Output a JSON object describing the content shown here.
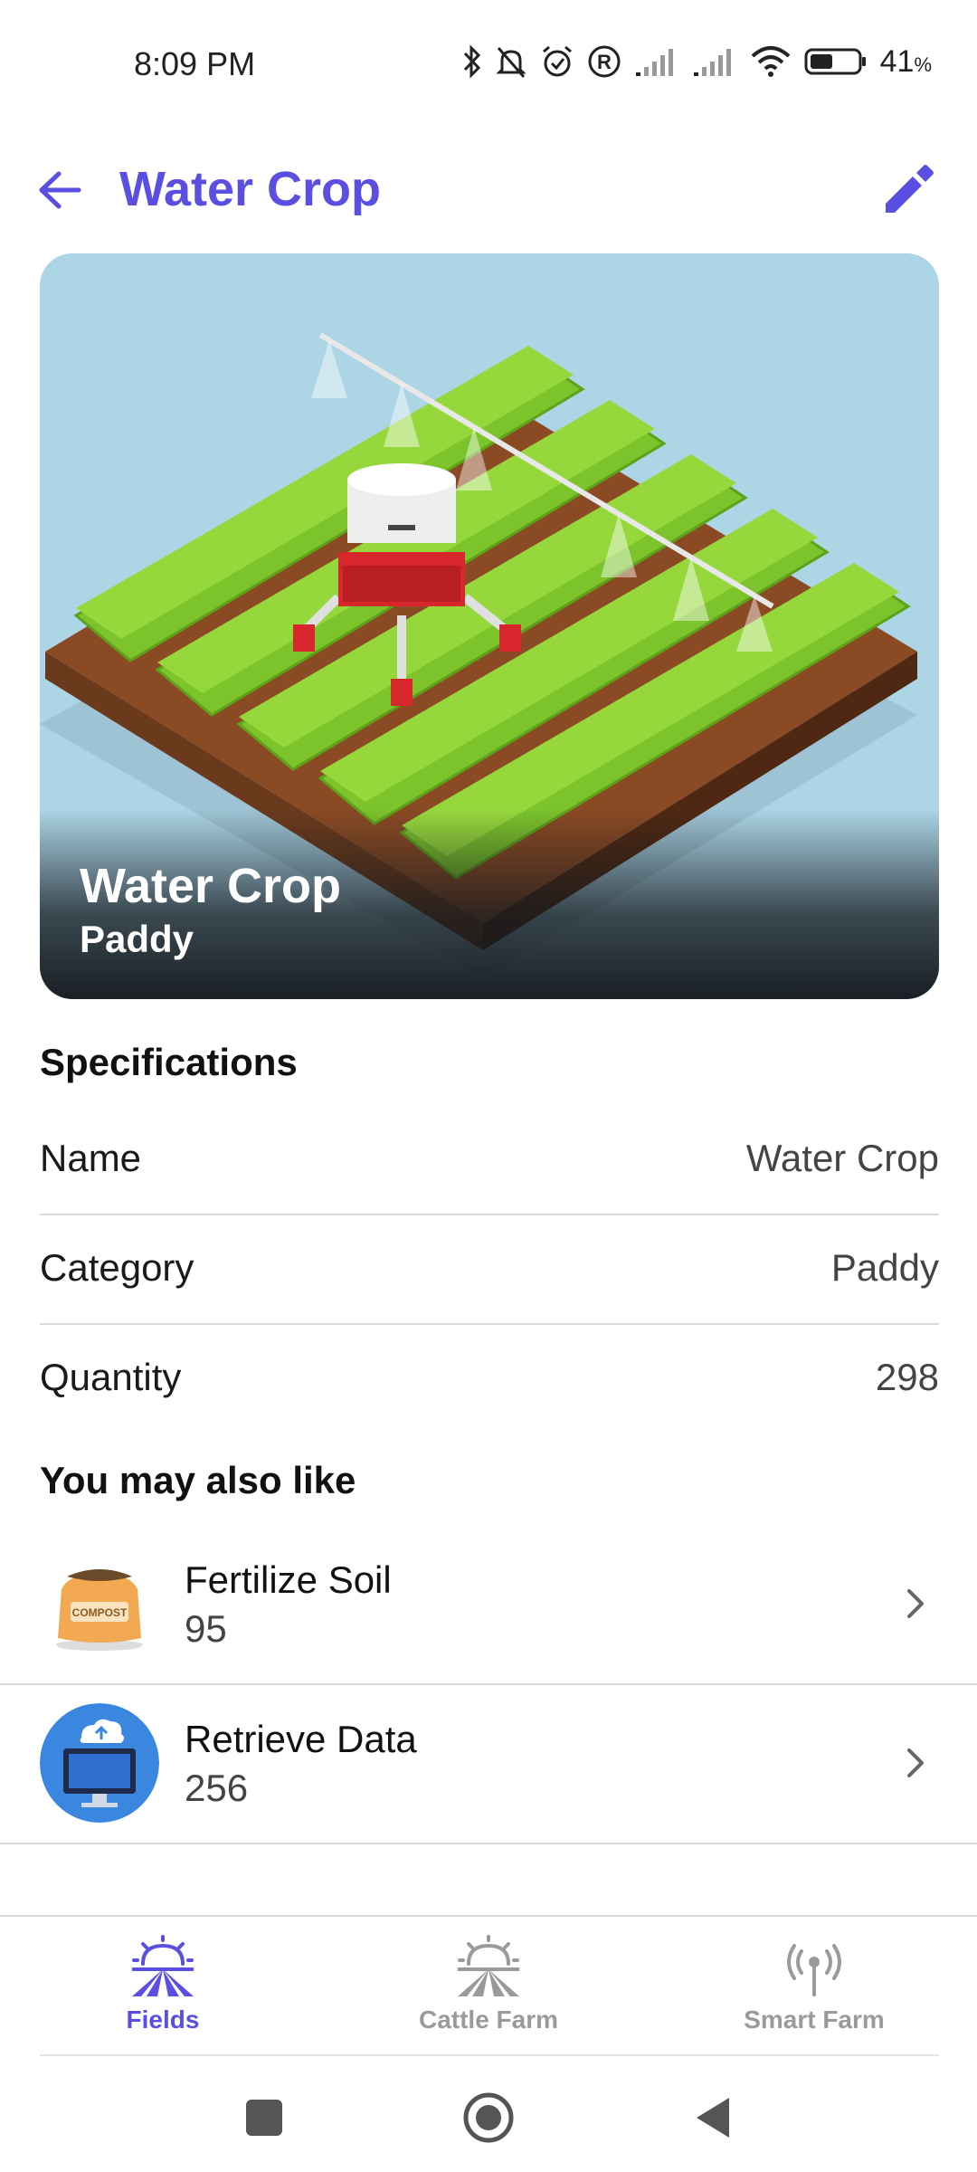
{
  "status_bar": {
    "time": "8:09 PM",
    "battery_percent": "41",
    "battery_unit": "%"
  },
  "app_bar": {
    "title": "Water Crop",
    "back_icon": "arrow-left-icon",
    "edit_icon": "pencil-icon"
  },
  "hero": {
    "title": "Water Crop",
    "subtitle": "Paddy",
    "image": "isometric-field-irrigation-robot"
  },
  "specifications": {
    "heading": "Specifications",
    "rows": [
      {
        "label": "Name",
        "value": "Water Crop"
      },
      {
        "label": "Category",
        "value": "Paddy"
      },
      {
        "label": "Quantity",
        "value": "298"
      }
    ]
  },
  "recommendations": {
    "heading": "You may also like",
    "items": [
      {
        "title": "Fertilize Soil",
        "subtitle": "95",
        "thumb": "compost-bag"
      },
      {
        "title": "Retrieve Data",
        "subtitle": "256",
        "thumb": "cloud-computer"
      }
    ]
  },
  "bottom_nav": {
    "items": [
      {
        "label": "Fields",
        "icon": "field-sunrise-icon",
        "active": true
      },
      {
        "label": "Cattle Farm",
        "icon": "field-sunrise-icon",
        "active": false
      },
      {
        "label": "Smart Farm",
        "icon": "antenna-signal-icon",
        "active": false
      }
    ]
  },
  "colors": {
    "accent": "#5a4fe0",
    "inactive": "#9a9a9a",
    "divider": "#d9d9d9"
  }
}
